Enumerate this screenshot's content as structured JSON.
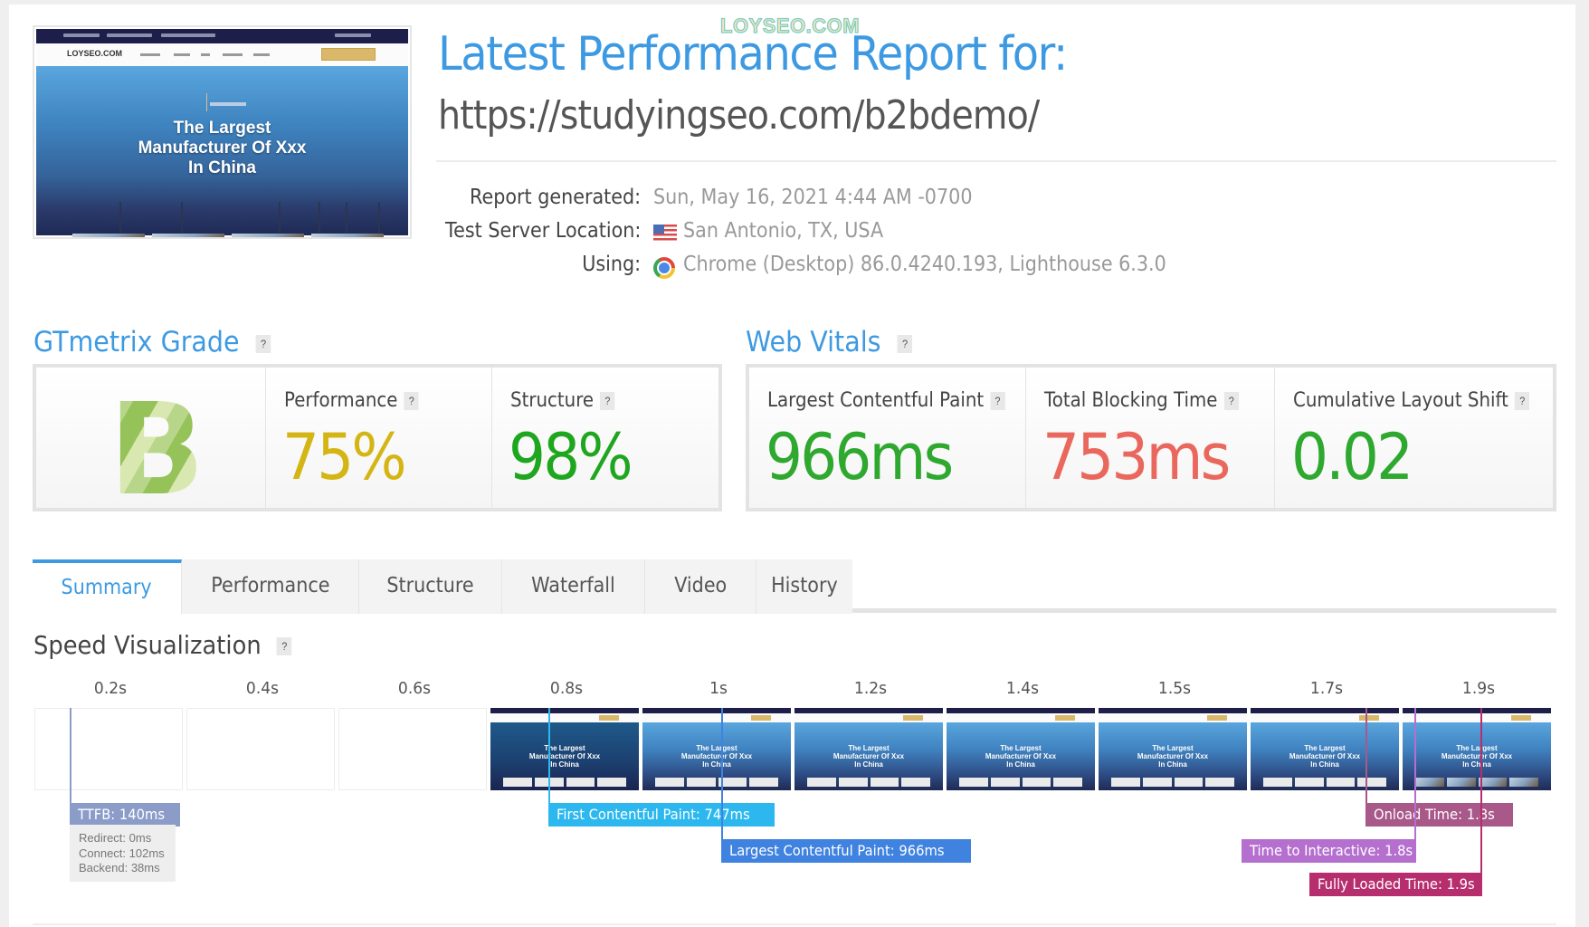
{
  "watermark": "LOYSEO.COM",
  "thumbnail": {
    "logo": "LOYSEO.COM",
    "hero_title": "The Largest\nManufacturer Of Xxx\nIn China"
  },
  "header": {
    "title": "Latest Performance Report for:",
    "url": "https://studyingseo.com/b2bdemo/"
  },
  "meta": {
    "report_generated_label": "Report generated:",
    "report_generated_value": "Sun, May 16, 2021 4:44 AM -0700",
    "server_location_label": "Test Server Location:",
    "server_location_value": "San Antonio, TX, USA",
    "server_flag_icon": "us-flag-icon",
    "using_label": "Using:",
    "using_value": "Chrome (Desktop) 86.0.4240.193, Lighthouse 6.3.0",
    "using_icon": "chrome-icon"
  },
  "gtmetrix_grade": {
    "title": "GTmetrix Grade",
    "help": "?",
    "grade": "B",
    "performance_label": "Performance",
    "performance_value": "75%",
    "structure_label": "Structure",
    "structure_value": "98%",
    "colors": {
      "performance": "#d4b514",
      "structure": "#1fa61f",
      "grade": "#8cbf50"
    }
  },
  "web_vitals": {
    "title": "Web Vitals",
    "help": "?",
    "items": [
      {
        "label": "Largest Contentful Paint",
        "value": "966ms",
        "color": "#2ea82e"
      },
      {
        "label": "Total Blocking Time",
        "value": "753ms",
        "color": "#e9675c"
      },
      {
        "label": "Cumulative Layout Shift",
        "value": "0.02",
        "color": "#2ea82e"
      }
    ]
  },
  "tabs": [
    {
      "label": "Summary",
      "active": true
    },
    {
      "label": "Performance",
      "active": false
    },
    {
      "label": "Structure",
      "active": false
    },
    {
      "label": "Waterfall",
      "active": false
    },
    {
      "label": "Video",
      "active": false
    },
    {
      "label": "History",
      "active": false
    }
  ],
  "speed_visualization": {
    "title": "Speed Visualization",
    "help": "?",
    "frames": [
      {
        "time": "0.2s",
        "state": "blank"
      },
      {
        "time": "0.4s",
        "state": "blank"
      },
      {
        "time": "0.6s",
        "state": "blank"
      },
      {
        "time": "0.8s",
        "state": "dark"
      },
      {
        "time": "1s",
        "state": "light"
      },
      {
        "time": "1.2s",
        "state": "light"
      },
      {
        "time": "1.4s",
        "state": "light"
      },
      {
        "time": "1.5s",
        "state": "light"
      },
      {
        "time": "1.7s",
        "state": "light"
      },
      {
        "time": "1.9s",
        "state": "complete"
      }
    ],
    "frame_text": "The Largest\nManufacturer Of Xxx\nIn China",
    "markers": {
      "ttfb": {
        "label": "TTFB: 140ms",
        "color": "#8b9cc9"
      },
      "fcp": {
        "label": "First Contentful Paint: 747ms",
        "color": "#2cb8ef"
      },
      "lcp": {
        "label": "Largest Contentful Paint: 966ms",
        "color": "#3f82e0"
      },
      "onload": {
        "label": "Onload Time: 1.8s",
        "color": "#a85889"
      },
      "tti": {
        "label": "Time to Interactive: 1.8s",
        "color": "#b56fcf"
      },
      "fully_loaded": {
        "label": "Fully Loaded Time: 1.9s",
        "color": "#b72e6e"
      }
    },
    "ttfb_breakdown": {
      "redirect": "Redirect: 0ms",
      "connect": "Connect: 102ms",
      "backend": "Backend: 38ms"
    }
  }
}
